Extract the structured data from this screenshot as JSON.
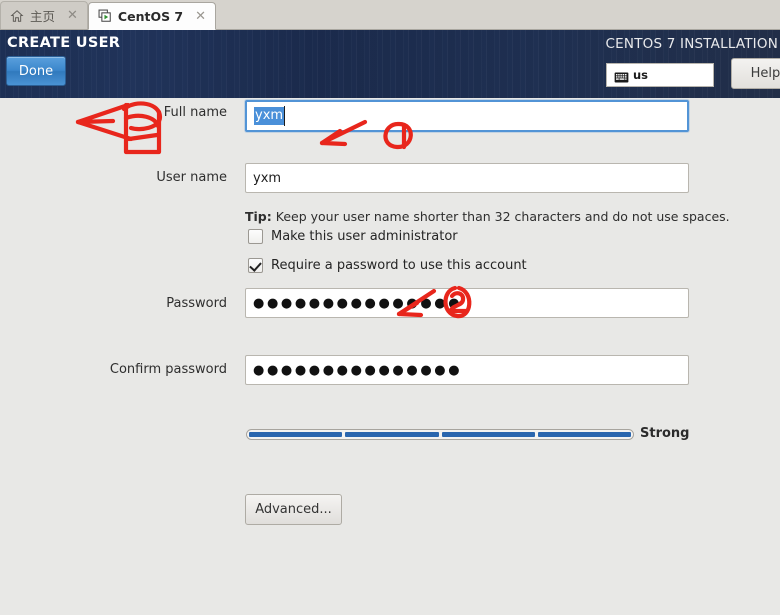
{
  "browser": {
    "tabs": [
      {
        "label": "主页",
        "icon": "home-icon",
        "close": "✕",
        "active": false
      },
      {
        "label": "CentOS 7",
        "icon": "virtual-machine-icon",
        "close": "✕",
        "active": true
      }
    ]
  },
  "header": {
    "title": "CREATE USER",
    "done_label": "Done",
    "installation_title": "CENTOS 7 INSTALLATION",
    "keyboard_layout": "us",
    "keyboard_icon": "keyboard-icon",
    "help_label": "Help!"
  },
  "form": {
    "full_name": {
      "label": "Full name",
      "value": "yxm",
      "selected": true,
      "focused": true
    },
    "user_name": {
      "label": "User name",
      "value": "yxm"
    },
    "tip": {
      "prefix": "Tip:",
      "text": "Keep your user name shorter than 32 characters and do not use spaces."
    },
    "admin_checkbox": {
      "label": "Make this user administrator",
      "checked": false
    },
    "require_password_checkbox": {
      "label": "Require a password to use this account",
      "checked": true
    },
    "password": {
      "label": "Password",
      "value": "●●●●●●●●●●●●●●●"
    },
    "strength": {
      "label": "Strong",
      "segments": 4,
      "filled": 4
    },
    "confirm_password": {
      "label": "Confirm password",
      "value": "●●●●●●●●●●●●●●●"
    },
    "advanced_label": "Advanced..."
  },
  "annotations": {
    "color": "#e8261c",
    "marks": [
      {
        "name": "arrow-to-done-button",
        "type": "arrow-left"
      },
      {
        "name": "handwritten-mark-near-done",
        "type": "scribble"
      },
      {
        "name": "arrow-to-full-name-field",
        "type": "arrow-left"
      },
      {
        "name": "circled-number-one",
        "type": "circled-glyph"
      },
      {
        "name": "arrow-to-password-field",
        "type": "arrow-left"
      },
      {
        "name": "circled-number-two",
        "type": "circled-glyph"
      }
    ]
  },
  "colors": {
    "header_bg": "#1e3054",
    "accent_blue": "#4a90d9",
    "meter_fill": "#2a66ae",
    "page_bg": "#e8e8e6",
    "annotation_red": "#e8261c"
  }
}
